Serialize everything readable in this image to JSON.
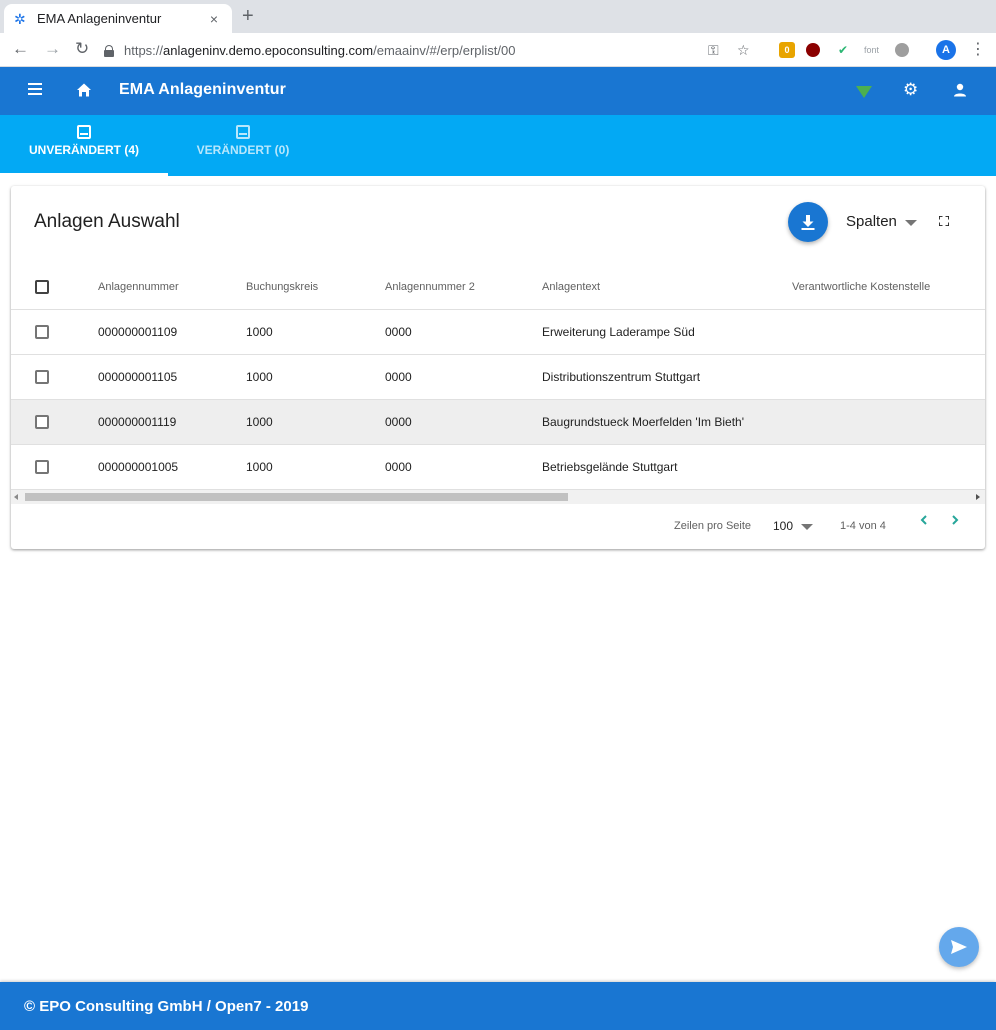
{
  "browser": {
    "tab_title": "EMA Anlageninventur",
    "tab_close": "×",
    "new_tab": "+",
    "url_scheme": "https://",
    "url_host": "anlageninv.demo.epoconsulting.com",
    "url_path": "/emaainv/#/erp/erplist/00",
    "ext_badge_count": "0",
    "ext_font_label": "font",
    "profile_initial": "A"
  },
  "appbar": {
    "title": "EMA Anlageninventur",
    "status_color": "#4caf50"
  },
  "tabs": [
    {
      "label": "UNVERÄNDERT (4)",
      "active": true
    },
    {
      "label": "VERÄNDERT (0)",
      "active": false
    }
  ],
  "card": {
    "title": "Anlagen Auswahl",
    "columns_button": "Spalten"
  },
  "table": {
    "headers": [
      "Anlagennummer",
      "Buchungskreis",
      "Anlagennummer 2",
      "Anlagentext",
      "Verantwortliche Kostenstelle"
    ],
    "rows": [
      {
        "anlagennummer": "000000001109",
        "buchungskreis": "1000",
        "anlagennummer2": "0000",
        "anlagentext": "Erweiterung Laderampe Süd",
        "kostenstelle": ""
      },
      {
        "anlagennummer": "000000001105",
        "buchungskreis": "1000",
        "anlagennummer2": "0000",
        "anlagentext": "Distributionszentrum Stuttgart",
        "kostenstelle": ""
      },
      {
        "anlagennummer": "000000001119",
        "buchungskreis": "1000",
        "anlagennummer2": "0000",
        "anlagentext": "Baugrundstueck Moerfelden 'Im Bieth'",
        "kostenstelle": ""
      },
      {
        "anlagennummer": "000000001005",
        "buchungskreis": "1000",
        "anlagennummer2": "0000",
        "anlagentext": "Betriebsgelände Stuttgart",
        "kostenstelle": ""
      }
    ]
  },
  "pagination": {
    "rows_per_page_label": "Zeilen pro Seite",
    "rows_per_page": "100",
    "range": "1-4 von 4"
  },
  "footer": {
    "text": "© EPO Consulting GmbH / Open7 - 2019"
  },
  "colors": {
    "primary": "#1976d2",
    "tabs": "#03a9f4",
    "pager_chevron": "#26a69a"
  }
}
